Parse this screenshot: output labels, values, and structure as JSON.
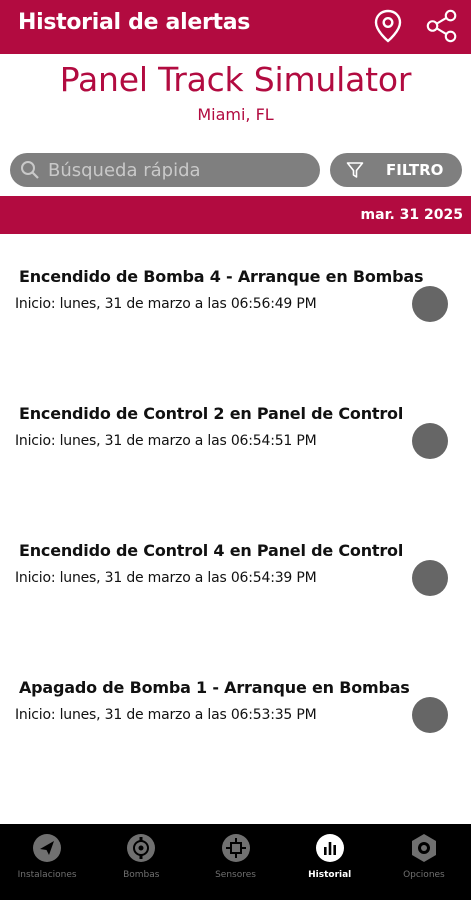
{
  "appbar": {
    "title": "Historial de alertas",
    "icons": [
      "location-pin-icon",
      "share-icon"
    ]
  },
  "header": {
    "title": "Panel Track Simulator",
    "location": "Miami, FL"
  },
  "search": {
    "placeholder": "Búsqueda rápida",
    "value": ""
  },
  "filter": {
    "label": "FILTRO"
  },
  "date_bar": {
    "date": "mar. 31 2025"
  },
  "alerts": [
    {
      "title": "Encendido de Bomba 4 - Arranque en Bombas",
      "start": "Inicio: lunes, 31 de marzo a las 06:56:49 PM",
      "status_color": "#666666"
    },
    {
      "title": "Encendido de Control 2 en Panel de Control",
      "start": "Inicio: lunes, 31 de marzo a las 06:54:51 PM",
      "status_color": "#666666"
    },
    {
      "title": "Encendido de Control 4 en Panel de Control",
      "start": "Inicio: lunes, 31 de marzo a las 06:54:39 PM",
      "status_color": "#666666"
    },
    {
      "title": "Apagado de Bomba 1 - Arranque en Bombas",
      "start": "Inicio: lunes, 31 de marzo a las 06:53:35 PM",
      "status_color": "#666666"
    }
  ],
  "bottom_nav": {
    "items": [
      {
        "label": "Instalaciones",
        "icon": "send-icon",
        "active": false
      },
      {
        "label": "Bombas",
        "icon": "pump-icon",
        "active": false
      },
      {
        "label": "Sensores",
        "icon": "sensor-icon",
        "active": false
      },
      {
        "label": "Historial",
        "icon": "history-chart-icon",
        "active": true
      },
      {
        "label": "Opciones",
        "icon": "settings-icon",
        "active": false
      }
    ]
  },
  "colors": {
    "brand": "#b20b40",
    "search_bg": "#7f7f7f",
    "nav_bg": "#000000"
  }
}
